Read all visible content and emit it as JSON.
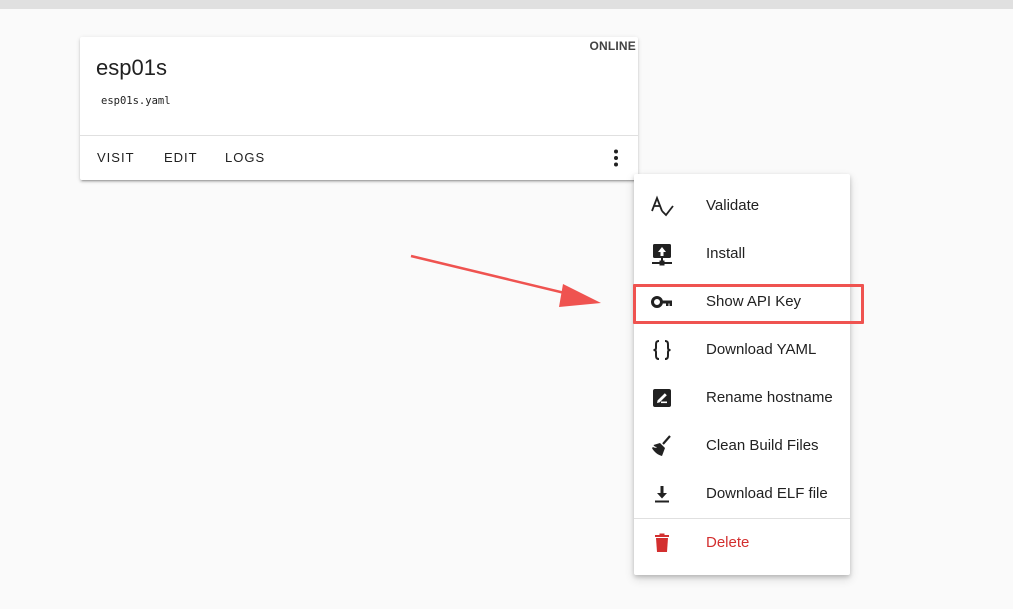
{
  "card": {
    "device_name": "esp01s",
    "config_file": "esp01s.yaml",
    "status": "ONLINE",
    "actions": {
      "visit": "VISIT",
      "edit": "EDIT",
      "logs": "LOGS"
    }
  },
  "menu": {
    "items": [
      {
        "label": "Validate",
        "icon": "spellcheck-icon"
      },
      {
        "label": "Install",
        "icon": "upload-network-icon"
      },
      {
        "label": "Show API Key",
        "icon": "key-icon"
      },
      {
        "label": "Download YAML",
        "icon": "code-braces-icon"
      },
      {
        "label": "Rename hostname",
        "icon": "rename-box-icon"
      },
      {
        "label": "Clean Build Files",
        "icon": "broom-icon"
      },
      {
        "label": "Download ELF file",
        "icon": "download-icon"
      },
      {
        "label": "Delete",
        "icon": "delete-icon"
      }
    ]
  },
  "colors": {
    "danger": "#d32f2f",
    "annotation": "#ef5350",
    "background": "#fafafa"
  }
}
